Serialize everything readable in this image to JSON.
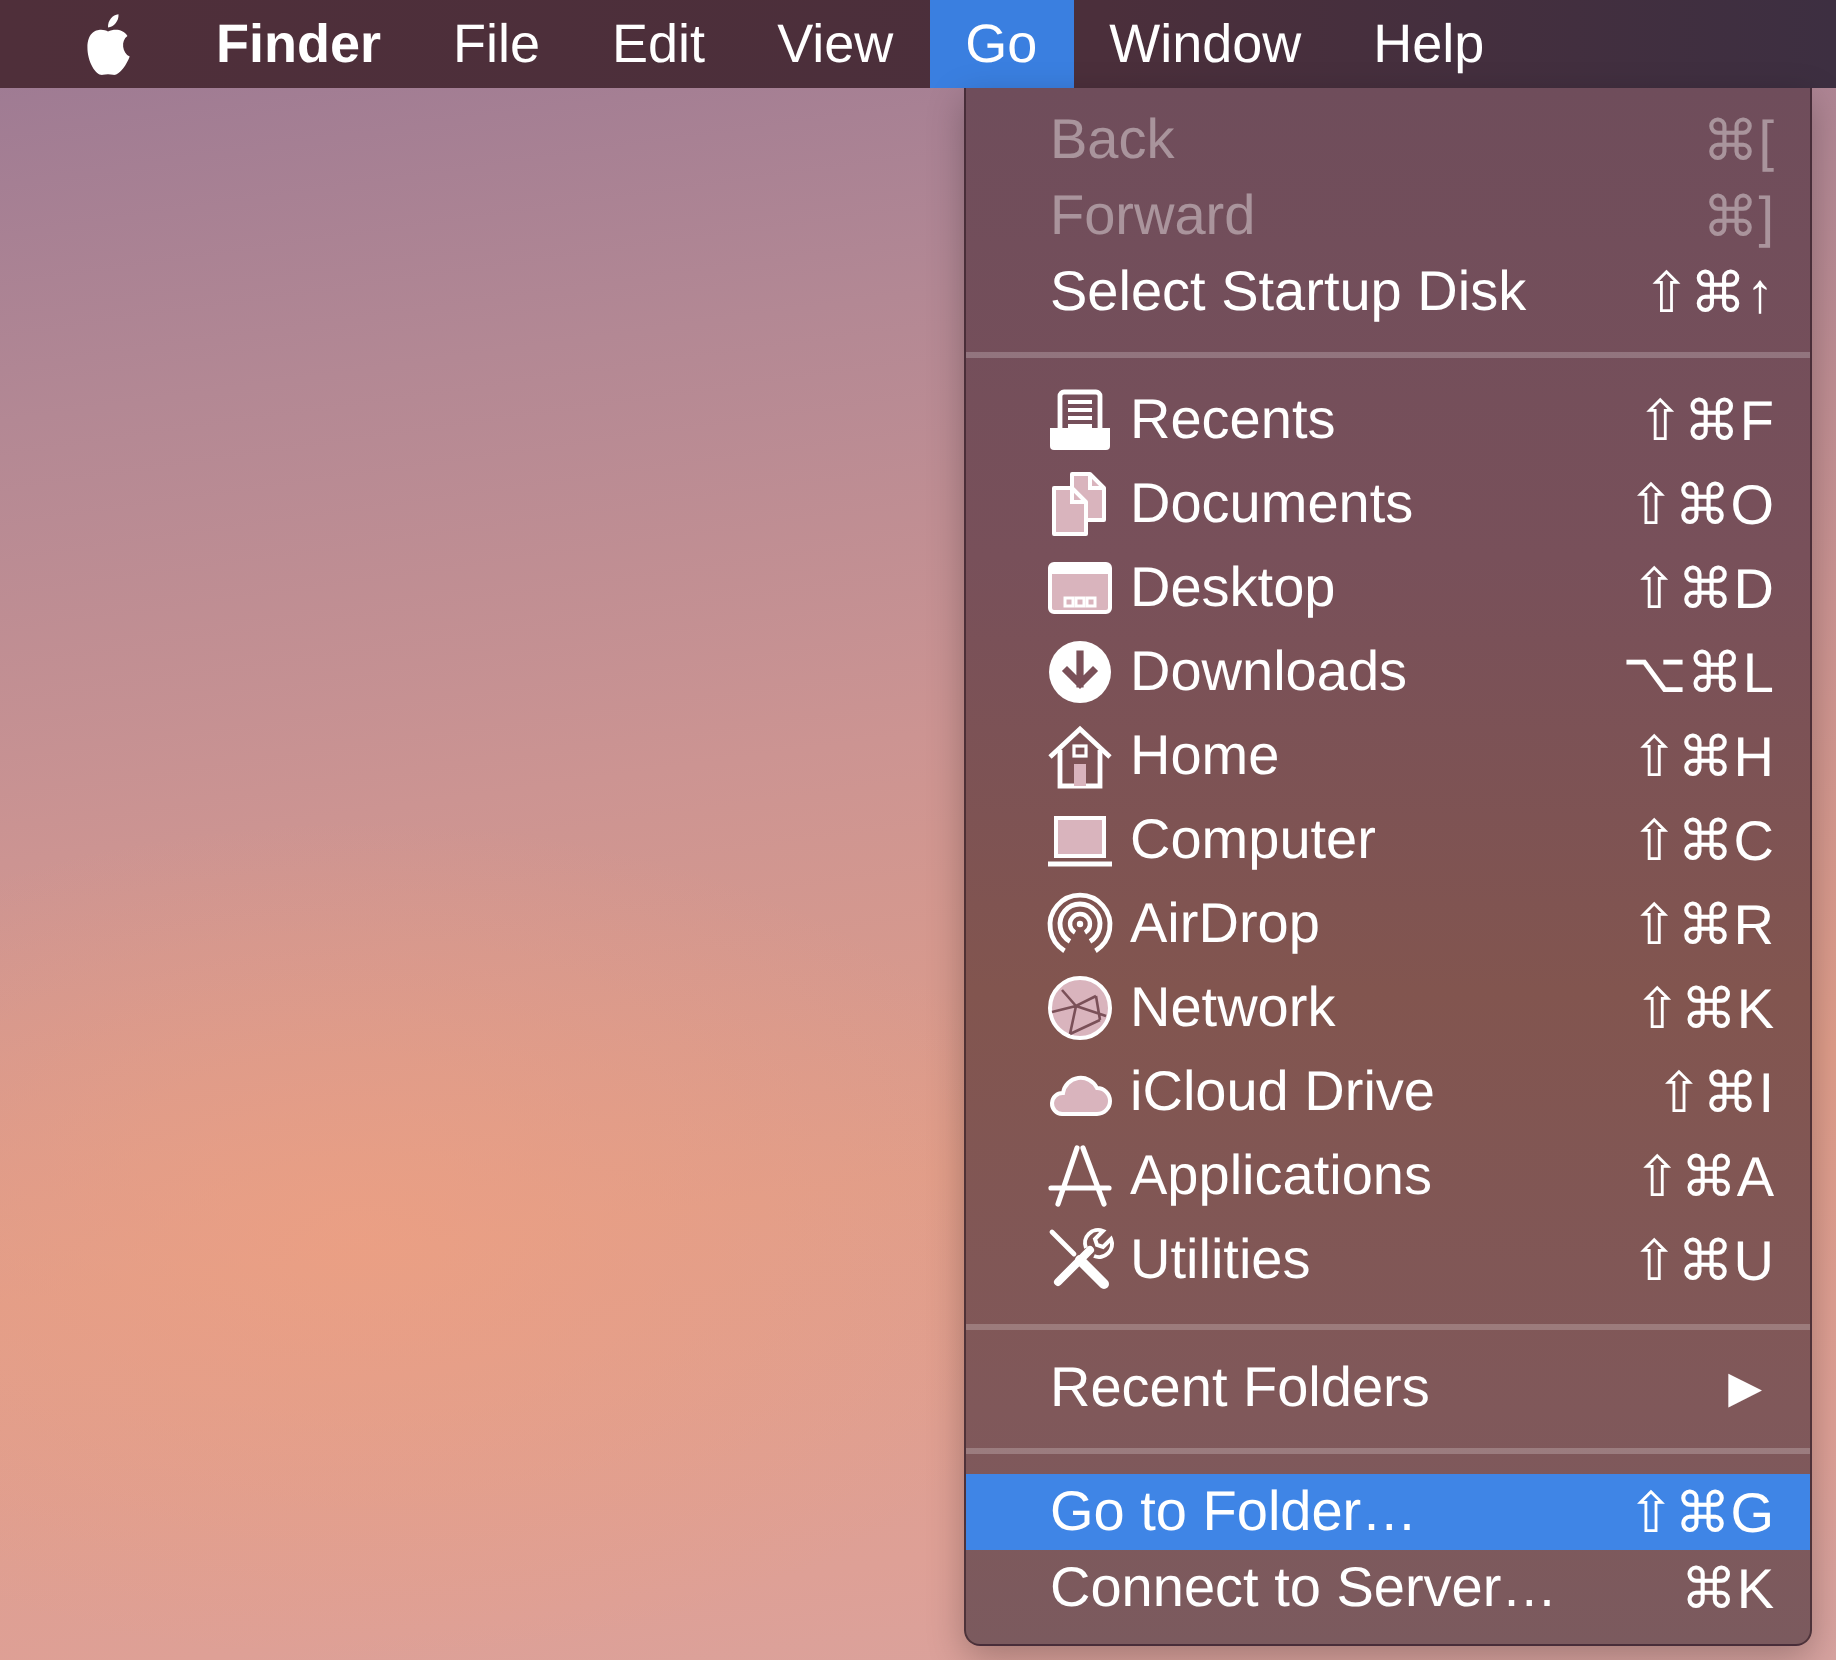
{
  "menu_bar": {
    "items": [
      {
        "kind": "app",
        "label": "Finder",
        "selected": false
      },
      {
        "kind": "menu",
        "label": "File",
        "selected": false
      },
      {
        "kind": "menu",
        "label": "Edit",
        "selected": false
      },
      {
        "kind": "menu",
        "label": "View",
        "selected": false
      },
      {
        "kind": "menu",
        "label": "Go",
        "selected": true
      },
      {
        "kind": "menu",
        "label": "Window",
        "selected": false
      },
      {
        "kind": "menu",
        "label": "Help",
        "selected": false
      }
    ]
  },
  "go_menu": {
    "sections": [
      {
        "kind": "plain",
        "items": [
          {
            "label": "Back",
            "shortcut": "⌘[",
            "disabled": true,
            "selected": false
          },
          {
            "label": "Forward",
            "shortcut": "⌘]",
            "disabled": true,
            "selected": false
          },
          {
            "label": "Select Startup Disk",
            "shortcut": "⇧⌘↑",
            "disabled": false,
            "selected": false
          }
        ]
      },
      {
        "kind": "places",
        "items": [
          {
            "label": "Recents",
            "shortcut": "⇧⌘F",
            "disabled": false,
            "selected": false
          },
          {
            "label": "Documents",
            "shortcut": "⇧⌘O",
            "disabled": false,
            "selected": false
          },
          {
            "label": "Desktop",
            "shortcut": "⇧⌘D",
            "disabled": false,
            "selected": false
          },
          {
            "label": "Downloads",
            "shortcut": "⌥⌘L",
            "disabled": false,
            "selected": false
          },
          {
            "label": "Home",
            "shortcut": "⇧⌘H",
            "disabled": false,
            "selected": false
          },
          {
            "label": "Computer",
            "shortcut": "⇧⌘C",
            "disabled": false,
            "selected": false
          },
          {
            "label": "AirDrop",
            "shortcut": "⇧⌘R",
            "disabled": false,
            "selected": false
          },
          {
            "label": "Network",
            "shortcut": "⇧⌘K",
            "disabled": false,
            "selected": false
          },
          {
            "label": "iCloud Drive",
            "shortcut": "⇧⌘I",
            "disabled": false,
            "selected": false
          },
          {
            "label": "Applications",
            "shortcut": "⇧⌘A",
            "disabled": false,
            "selected": false
          },
          {
            "label": "Utilities",
            "shortcut": "⇧⌘U",
            "disabled": false,
            "selected": false
          }
        ]
      },
      {
        "kind": "plain",
        "items": [
          {
            "label": "Recent Folders",
            "submenu": "▶",
            "disabled": false,
            "selected": false
          }
        ]
      },
      {
        "kind": "plain",
        "items": [
          {
            "label": "Go to Folder…",
            "shortcut": "⇧⌘G",
            "disabled": false,
            "selected": true
          },
          {
            "label": "Connect to Server…",
            "shortcut": "⌘K",
            "disabled": false,
            "selected": false
          }
        ]
      }
    ]
  }
}
